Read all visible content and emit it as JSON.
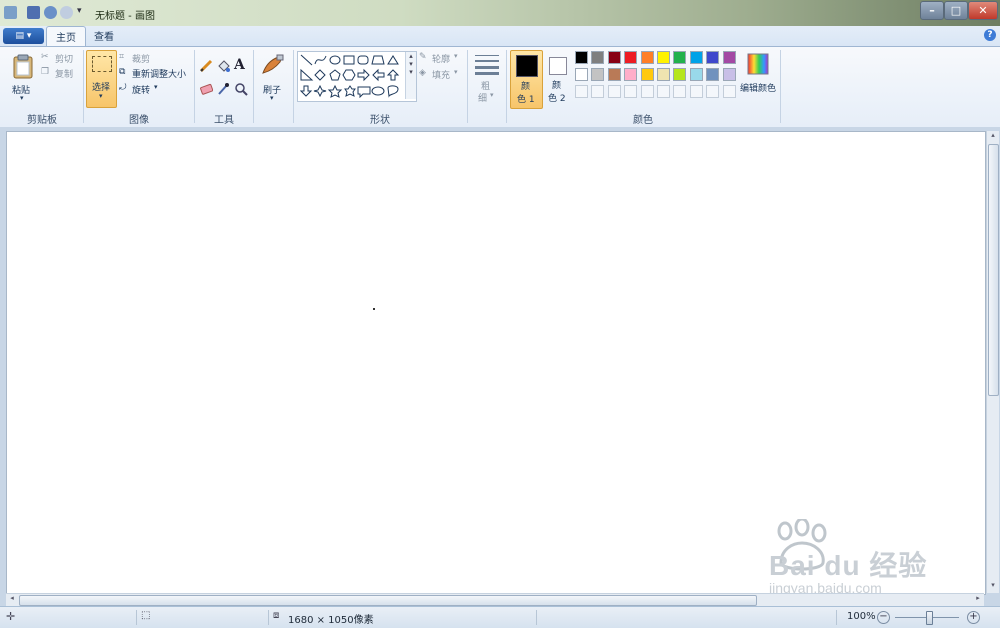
{
  "window": {
    "title": "无标题 - 画图",
    "controls": {
      "minimize": "–",
      "maximize": "□",
      "close": "✕"
    }
  },
  "tabs": {
    "home": "主页",
    "view": "查看"
  },
  "file_menu_icon": "menu-icon",
  "help": "?",
  "clipboard": {
    "paste": "粘贴",
    "cut": "剪切",
    "copy": "复制",
    "label": "剪贴板"
  },
  "image": {
    "select": "选择",
    "crop": "裁剪",
    "resize": "重新调整大小",
    "rotate": "旋转",
    "label": "图像"
  },
  "tools": {
    "text_glyph": "A",
    "label": "工具"
  },
  "brushes": {
    "label": "刷子"
  },
  "shapes": {
    "outline": "轮廓",
    "fill": "填充",
    "label": "形状"
  },
  "size": {
    "label_top": "粗",
    "label_bottom": "细"
  },
  "colors": {
    "color1_top": "颜",
    "color1_bottom": "色 1",
    "color2_top": "颜",
    "color2_bottom": "色 2",
    "edit": "编辑颜色",
    "label": "颜色",
    "color1_value": "#000000",
    "color2_value": "#ffffff",
    "palette_row1": [
      "#000000",
      "#7f7f7f",
      "#880015",
      "#ed1c24",
      "#ff7f27",
      "#fff200",
      "#22b14c",
      "#00a2e8",
      "#3f48cc",
      "#a349a4"
    ],
    "palette_row2": [
      "#ffffff",
      "#c3c3c3",
      "#b97a57",
      "#ffaec9",
      "#ffc90e",
      "#efe4b0",
      "#b5e61d",
      "#99d9ea",
      "#7092be",
      "#c8bfe7"
    ]
  },
  "status": {
    "dimensions": "1680 × 1050像素",
    "zoom": "100%"
  },
  "watermark": {
    "brand": "Bai du 经验",
    "url": "jingyan.baidu.com"
  }
}
